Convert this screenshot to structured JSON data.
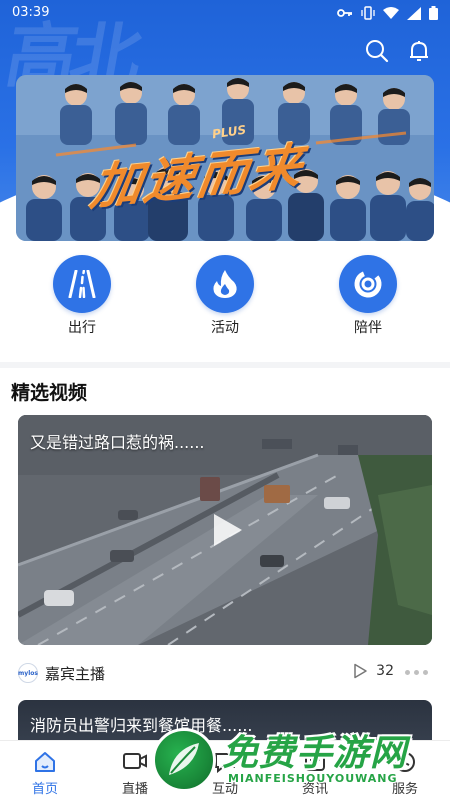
{
  "status_bar": {
    "time": "03:39"
  },
  "header": {
    "background_color": "#2a71e6",
    "watermark_glyph": "高北",
    "icons": [
      "search-icon",
      "bell-icon"
    ]
  },
  "banner": {
    "title": "加速而来",
    "plus_tag": "PLUS"
  },
  "quick_entries": [
    {
      "label": "出行",
      "icon": "road-icon"
    },
    {
      "label": "活动",
      "icon": "flame-icon"
    },
    {
      "label": "陪伴",
      "icon": "ring-icon"
    }
  ],
  "section": {
    "title": "精选视频"
  },
  "video_1": {
    "title": "又是错过路口惹的祸......",
    "channel": "嘉宾主播",
    "channel_logo_text": "mylos",
    "plays": "32"
  },
  "video_2": {
    "title": "消防员出警归来到餐馆用餐......"
  },
  "tabs": [
    {
      "label": "首页",
      "icon": "home-icon",
      "active": true
    },
    {
      "label": "直播",
      "icon": "live-icon",
      "active": false
    },
    {
      "label": "互动",
      "icon": "interact-icon",
      "active": false
    },
    {
      "label": "资讯",
      "icon": "news-icon",
      "active": false
    },
    {
      "label": "服务",
      "icon": "service-icon",
      "active": false
    }
  ],
  "overlay_watermark": {
    "text": "免费手游网",
    "sub": "MIANFEISHOUYOUWANG"
  },
  "colors": {
    "accent": "#2f73e6",
    "watermark_green": "#26a446"
  }
}
